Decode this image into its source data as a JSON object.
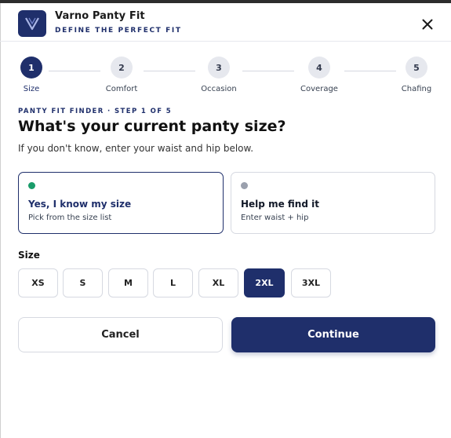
{
  "app": {
    "name": "Varno Panty Fit",
    "tagline": "DEFINE THE PERFECT FIT",
    "logo_letter": "V",
    "icons": {
      "close": "close-icon",
      "logo": "v-logo-icon"
    },
    "colors": {
      "brand": "#1f2f6b",
      "selected_dot": "#1a9c6a",
      "unselected_dot": "#9aa0ad"
    }
  },
  "stepper": {
    "steps": [
      {
        "number": "1",
        "label": "Size",
        "active": true
      },
      {
        "number": "2",
        "label": "Comfort",
        "active": false
      },
      {
        "number": "3",
        "label": "Occasion",
        "active": false
      },
      {
        "number": "4",
        "label": "Coverage",
        "active": false
      },
      {
        "number": "5",
        "label": "Chafing",
        "active": false
      }
    ]
  },
  "form": {
    "eyebrow": "PANTY FIT FINDER · STEP 1 OF 5",
    "question": "What's your current panty size?",
    "subtext": "If you don't know, enter your waist and hip below.",
    "options": [
      {
        "title": "Yes, I know my size",
        "subtitle": "Pick from the size list",
        "selected": true
      },
      {
        "title": "Help me find it",
        "subtitle": "Enter waist + hip",
        "selected": false
      }
    ],
    "size_label": "Size",
    "sizes": [
      "XS",
      "S",
      "M",
      "L",
      "XL",
      "2XL",
      "3XL"
    ],
    "selected_size": "2XL"
  },
  "actions": {
    "cancel_label": "Cancel",
    "continue_label": "Continue"
  }
}
